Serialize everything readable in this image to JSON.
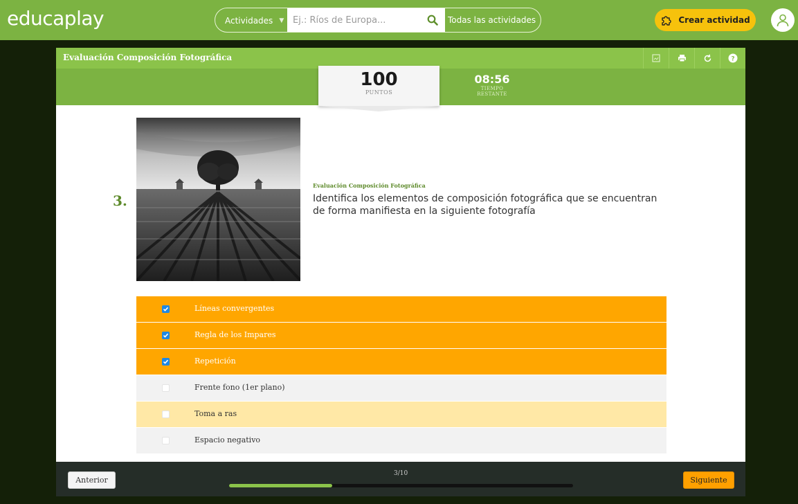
{
  "header": {
    "logo": "educaplay",
    "category_label": "Actividades",
    "search_placeholder": "Ej.: Ríos de Europa...",
    "all_activities_label": "Todas las actividades",
    "create_label": "Crear actividad"
  },
  "activity": {
    "title": "Evaluación Composición Fotográfica",
    "score": "100",
    "score_label": "PUNTOS",
    "time": "08:56",
    "time_label": "TIEMPO RESTANTE",
    "question_number": "3.",
    "question_subtitle": "Evaluación Composición Fotográfica",
    "question_text": "Identifica los elementos de composición fotográfica que se encuentran de forma manifiesta en la siguiente fotografía",
    "answers": [
      {
        "label": "Líneas convergentes",
        "checked": true,
        "color": "#ffa600"
      },
      {
        "label": "Regla de los Impares",
        "checked": true,
        "color": "#ffa600"
      },
      {
        "label": "Repetición",
        "checked": true,
        "color": "#ffa600"
      },
      {
        "label": "Frente fono (1er plano)",
        "checked": false,
        "color": "#f2f2f2"
      },
      {
        "label": "Toma a ras",
        "checked": false,
        "color": "#ffe8a6"
      },
      {
        "label": "Espacio negativo",
        "checked": false,
        "color": "#f2f2f2"
      }
    ]
  },
  "footer": {
    "prev_label": "Anterior",
    "next_label": "Siguiente",
    "progress_text": "3/10",
    "progress_fraction": 0.3
  },
  "colors": {
    "brand_green": "#7cb342",
    "selected_answer": "#ffa600",
    "accent_yellow": "#f6c20c"
  }
}
